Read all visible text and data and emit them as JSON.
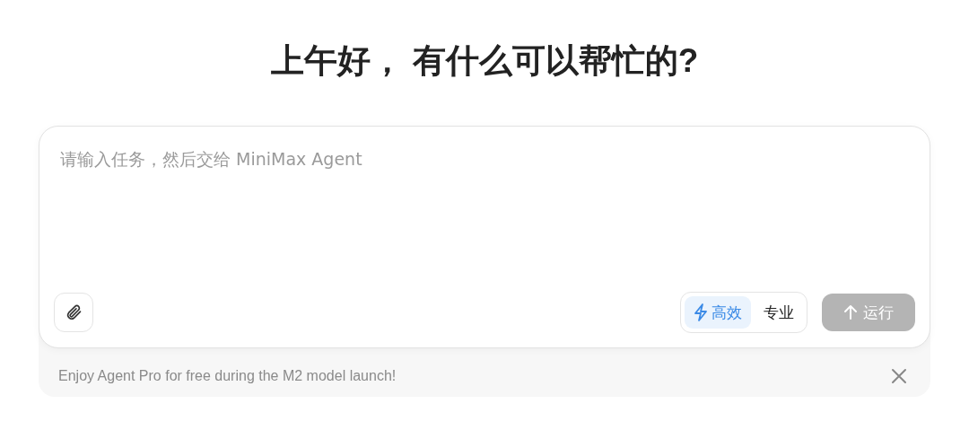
{
  "greeting": "上午好， 有什么可以帮忙的?",
  "composer": {
    "placeholder": "请输入任务，然后交给 MiniMax Agent",
    "modes": [
      {
        "label": "高效",
        "kind": "fast",
        "selected": true
      },
      {
        "label": "专业",
        "kind": "pro",
        "selected": false
      }
    ],
    "run_button": {
      "label": "运行",
      "disabled": true
    }
  },
  "banner": {
    "text": "Enjoy Agent Pro for free during the M2 model launch!"
  }
}
